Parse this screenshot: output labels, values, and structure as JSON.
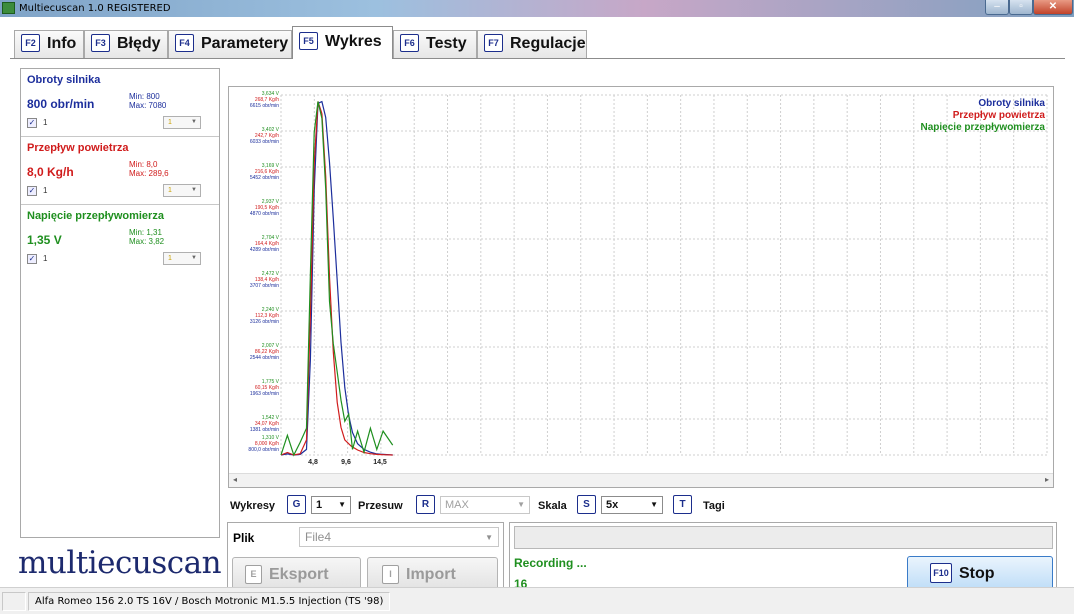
{
  "window": {
    "title": "Multiecuscan 1.0 REGISTERED",
    "minimize": "‒",
    "maximize": "▫",
    "close": "✕"
  },
  "tabs": [
    {
      "key": "F2",
      "label": "Info"
    },
    {
      "key": "F3",
      "label": "Błędy"
    },
    {
      "key": "F4",
      "label": "Parametery"
    },
    {
      "key": "F5",
      "label": "Wykres",
      "active": true
    },
    {
      "key": "F6",
      "label": "Testy"
    },
    {
      "key": "F7",
      "label": "Regulacje"
    }
  ],
  "params": [
    {
      "name": "Obroty silnika",
      "value": "800 obr/min",
      "min": "Min: 800",
      "max": "Max: 7080",
      "check_label": "1",
      "combo": "1",
      "color": "#1c2e9c"
    },
    {
      "name": "Przepływ powietrza",
      "value": "8,0 Kg/h",
      "min": "Min: 8,0",
      "max": "Max: 289,6",
      "check_label": "1",
      "combo": "1",
      "color": "#d01c1c"
    },
    {
      "name": "Napięcie przepływomierza",
      "value": "1,35 V",
      "min": "Min: 1,31",
      "max": "Max: 3,82",
      "check_label": "1",
      "combo": "1",
      "color": "#1f8f1f"
    }
  ],
  "brand": "multiecuscan",
  "chart_data": {
    "type": "line",
    "legend_position": "top-right",
    "grid": true,
    "x_ticks": [
      "4,8",
      "9,6",
      "14,5"
    ],
    "y_ticks": [
      {
        "v": "3,634 V",
        "kg": "268,7 Kg/h",
        "rpm": "6615 obr/min"
      },
      {
        "v": "3,402 V",
        "kg": "242,7 Kg/h",
        "rpm": "6033 obr/min"
      },
      {
        "v": "3,169 V",
        "kg": "216,6 Kg/h",
        "rpm": "5452 obr/min"
      },
      {
        "v": "2,937 V",
        "kg": "190,5 Kg/h",
        "rpm": "4870 obr/min"
      },
      {
        "v": "2,704 V",
        "kg": "164,4 Kg/h",
        "rpm": "4289 obr/min"
      },
      {
        "v": "2,472 V",
        "kg": "138,4 Kg/h",
        "rpm": "3707 obr/min"
      },
      {
        "v": "2,240 V",
        "kg": "112,3 Kg/h",
        "rpm": "3126 obr/min"
      },
      {
        "v": "2,007 V",
        "kg": "86,22 Kg/h",
        "rpm": "2544 obr/min"
      },
      {
        "v": "1,775 V",
        "kg": "60,15 Kg/h",
        "rpm": "1963 obr/min"
      },
      {
        "v": "1,542 V",
        "kg": "34,07 Kg/h",
        "rpm": "1381 obr/min"
      },
      {
        "v": "1,310 V",
        "kg": "8,000 Kg/h",
        "rpm": "800,0 obr/min"
      }
    ],
    "series": [
      {
        "name": "Obroty silnika",
        "color": "#1c2e9c",
        "x": [
          0.0,
          1.0,
          2.0,
          3.0,
          4.0,
          4.6,
          5.2,
          5.8,
          6.4,
          7.0,
          7.6,
          8.2,
          8.8,
          9.4,
          10.0,
          10.6,
          11.2,
          12.0,
          13.0,
          14.0,
          15.0,
          16.0,
          17.5
        ],
        "y": [
          800,
          820,
          800,
          810,
          900,
          2500,
          5500,
          7050,
          7080,
          6800,
          6000,
          5000,
          3900,
          2800,
          2000,
          1500,
          1200,
          1000,
          900,
          850,
          820,
          810,
          800
        ]
      },
      {
        "name": "Przepływ powietrza",
        "color": "#d01c1c",
        "x": [
          0.0,
          1.0,
          2.0,
          3.0,
          4.0,
          4.6,
          5.2,
          5.8,
          6.4,
          7.0,
          7.6,
          8.2,
          8.8,
          9.4,
          10.0,
          11.0,
          12.0,
          13.0,
          14.0,
          15.0,
          16.0,
          17.5
        ],
        "y": [
          8.0,
          10,
          8.0,
          9,
          20,
          120,
          240,
          289.6,
          280,
          230,
          150,
          90,
          50,
          30,
          20,
          15,
          12,
          10,
          9,
          8.5,
          8.2,
          8.0
        ]
      },
      {
        "name": "Napięcie przepływomierza",
        "color": "#1f8f1f",
        "x": [
          0.0,
          1.0,
          2.0,
          3.0,
          4.0,
          4.6,
          5.2,
          5.8,
          6.4,
          7.0,
          7.6,
          8.2,
          8.8,
          9.4,
          10.0,
          10.6,
          11.2,
          12.0,
          13.0,
          14.0,
          15.0,
          16.0,
          17.5
        ],
        "y": [
          1.31,
          1.45,
          1.31,
          1.4,
          1.5,
          2.6,
          3.6,
          3.82,
          3.7,
          3.2,
          2.4,
          2.1,
          1.9,
          1.7,
          1.55,
          1.6,
          1.35,
          1.48,
          1.33,
          1.5,
          1.35,
          1.48,
          1.38
        ]
      }
    ],
    "xlim": [
      0,
      120
    ],
    "ylim_rpm": [
      800,
      7197
    ]
  },
  "controls": {
    "wykresy_label": "Wykresy",
    "wykresy_key": "G",
    "wykresy_value": "1",
    "przesuw_label": "Przesuw",
    "przesuw_key": "R",
    "przesuw_value": "MAX",
    "skala_label": "Skala",
    "skala_key": "S",
    "skala_value": "5x",
    "tagi_key": "T",
    "tagi_label": "Tagi"
  },
  "file": {
    "label": "Plik",
    "value": "File4",
    "export_key": "E",
    "export_label": "Eksport",
    "import_key": "I",
    "import_label": "Import"
  },
  "recording": {
    "status": "Recording ...",
    "count": "16",
    "stop_key": "F10",
    "stop_label": "Stop"
  },
  "statusbar": {
    "vehicle": "Alfa Romeo 156 2.0 TS 16V / Bosch Motronic M1.5.5 Injection (TS '98)"
  }
}
